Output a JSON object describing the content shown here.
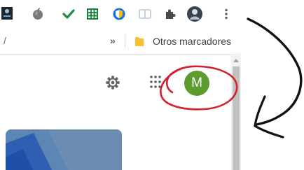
{
  "toolbar": {
    "extensions": [
      {
        "name": "page-extension-icon"
      },
      {
        "name": "tomato-extension-icon"
      },
      {
        "name": "checkmark-extension-icon"
      },
      {
        "name": "sheets-extension-icon"
      },
      {
        "name": "shield-extension-icon"
      },
      {
        "name": "reader-extension-icon"
      },
      {
        "name": "puzzle-piece-icon"
      },
      {
        "name": "profile-avatar-icon"
      },
      {
        "name": "more-vert-icon"
      }
    ]
  },
  "bookmarks": {
    "left_fragment": "/",
    "chevron": "»",
    "other_label": "Otros marcadores"
  },
  "header": {
    "avatar_letter": "M"
  },
  "colors": {
    "avatar": "#5d9b2f",
    "annotation": "#d4202c",
    "check": "#1e8e3e",
    "sheets": "#188038"
  }
}
